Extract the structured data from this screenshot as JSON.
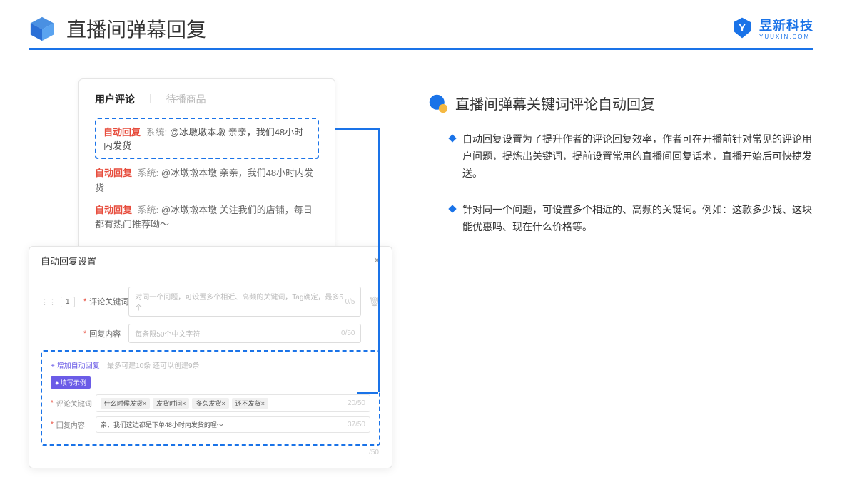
{
  "header": {
    "title": "直播间弹幕回复"
  },
  "logo": {
    "name": "昱新科技",
    "sub": "YUUXIN.COM"
  },
  "comments": {
    "tabs": {
      "active": "用户评论",
      "inactive": "待播商品"
    },
    "highlighted": {
      "tag": "自动回复",
      "sys": "系统:",
      "text": "@冰墩墩本墩 亲亲，我们48小时内发货"
    },
    "row2": {
      "tag": "自动回复",
      "sys": "系统:",
      "text": "@冰墩墩本墩 亲亲，我们48小时内发货"
    },
    "row3": {
      "tag": "自动回复",
      "sys": "系统:",
      "text": "@冰墩墩本墩 关注我们的店铺，每日都有热门推荐呦～"
    }
  },
  "settings": {
    "title": "自动回复设置",
    "num": "1",
    "keyword_label": "评论关键词",
    "keyword_placeholder": "对同一个问题，可设置多个相近、高频的关键词，Tag确定，最多5个",
    "keyword_counter": "0/5",
    "content_label": "回复内容",
    "content_placeholder": "每条限50个中文字符",
    "content_counter": "0/50",
    "add_link": "+ 增加自动回复",
    "add_hint": "最多可建10条 还可以创建9条",
    "example_tag": "● 填写示例",
    "ex_kw_label": "评论关键词",
    "chips": [
      "什么时候发货×",
      "发货时间×",
      "多久发货×",
      "还不发货×"
    ],
    "ex_kw_counter": "20/50",
    "ex_ct_label": "回复内容",
    "ex_ct_text": "亲，我们这边都是下单48小时内发货的喔～",
    "ex_ct_counter": "37/50",
    "outer_counter": "/50"
  },
  "right": {
    "title": "直播间弹幕关键词评论自动回复",
    "bullets": [
      "自动回复设置为了提升作者的评论回复效率，作者可在开播前针对常见的评论用户问题，提炼出关键词，提前设置常用的直播间回复话术，直播开始后可快捷发送。",
      "针对同一个问题，可设置多个相近的、高频的关键词。例如：这款多少钱、这块能优惠吗、现在什么价格等。"
    ]
  }
}
